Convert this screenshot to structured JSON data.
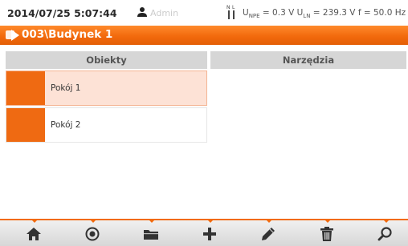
{
  "status": {
    "datetime": "2014/07/25 5:07:44",
    "user": "Admin",
    "u_npe_label": "U",
    "u_npe_sub": "NPE",
    "u_npe_value": " = 0.3 V ",
    "u_ln_label": "U",
    "u_ln_sub": "LN",
    "u_ln_value": " = 239.3 V ",
    "freq": "f = 50.0 Hz"
  },
  "header": {
    "title": "003\\Budynek 1"
  },
  "columns": {
    "left": "Obiekty",
    "right": "Narzędzia"
  },
  "objects": [
    {
      "label": "Pokój 1",
      "selected": true
    },
    {
      "label": "Pokój 2",
      "selected": false
    }
  ],
  "toolbar": {
    "icons": [
      "home-icon",
      "record-icon",
      "folder-icon",
      "add-icon",
      "edit-icon",
      "delete-icon",
      "search-icon"
    ]
  },
  "colors": {
    "accent": "#f26a0d",
    "selected_row": "#fde2d6"
  }
}
